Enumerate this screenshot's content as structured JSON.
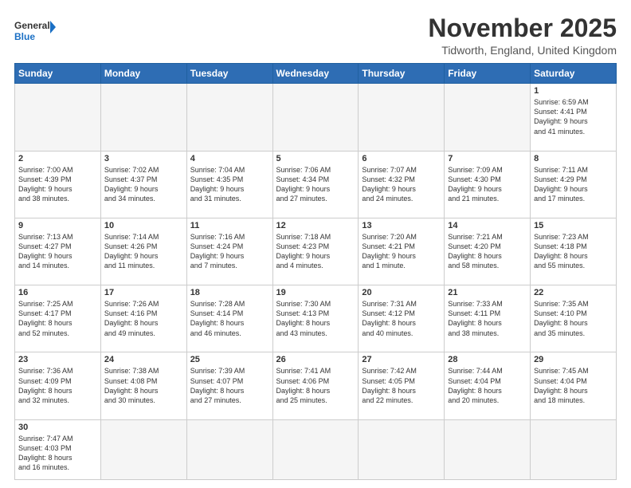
{
  "header": {
    "logo_general": "General",
    "logo_blue": "Blue",
    "month": "November 2025",
    "location": "Tidworth, England, United Kingdom"
  },
  "weekdays": [
    "Sunday",
    "Monday",
    "Tuesday",
    "Wednesday",
    "Thursday",
    "Friday",
    "Saturday"
  ],
  "weeks": [
    [
      {
        "day": "",
        "info": ""
      },
      {
        "day": "",
        "info": ""
      },
      {
        "day": "",
        "info": ""
      },
      {
        "day": "",
        "info": ""
      },
      {
        "day": "",
        "info": ""
      },
      {
        "day": "",
        "info": ""
      },
      {
        "day": "1",
        "info": "Sunrise: 6:59 AM\nSunset: 4:41 PM\nDaylight: 9 hours\nand 41 minutes."
      }
    ],
    [
      {
        "day": "2",
        "info": "Sunrise: 7:00 AM\nSunset: 4:39 PM\nDaylight: 9 hours\nand 38 minutes."
      },
      {
        "day": "3",
        "info": "Sunrise: 7:02 AM\nSunset: 4:37 PM\nDaylight: 9 hours\nand 34 minutes."
      },
      {
        "day": "4",
        "info": "Sunrise: 7:04 AM\nSunset: 4:35 PM\nDaylight: 9 hours\nand 31 minutes."
      },
      {
        "day": "5",
        "info": "Sunrise: 7:06 AM\nSunset: 4:34 PM\nDaylight: 9 hours\nand 27 minutes."
      },
      {
        "day": "6",
        "info": "Sunrise: 7:07 AM\nSunset: 4:32 PM\nDaylight: 9 hours\nand 24 minutes."
      },
      {
        "day": "7",
        "info": "Sunrise: 7:09 AM\nSunset: 4:30 PM\nDaylight: 9 hours\nand 21 minutes."
      },
      {
        "day": "8",
        "info": "Sunrise: 7:11 AM\nSunset: 4:29 PM\nDaylight: 9 hours\nand 17 minutes."
      }
    ],
    [
      {
        "day": "9",
        "info": "Sunrise: 7:13 AM\nSunset: 4:27 PM\nDaylight: 9 hours\nand 14 minutes."
      },
      {
        "day": "10",
        "info": "Sunrise: 7:14 AM\nSunset: 4:26 PM\nDaylight: 9 hours\nand 11 minutes."
      },
      {
        "day": "11",
        "info": "Sunrise: 7:16 AM\nSunset: 4:24 PM\nDaylight: 9 hours\nand 7 minutes."
      },
      {
        "day": "12",
        "info": "Sunrise: 7:18 AM\nSunset: 4:23 PM\nDaylight: 9 hours\nand 4 minutes."
      },
      {
        "day": "13",
        "info": "Sunrise: 7:20 AM\nSunset: 4:21 PM\nDaylight: 9 hours\nand 1 minute."
      },
      {
        "day": "14",
        "info": "Sunrise: 7:21 AM\nSunset: 4:20 PM\nDaylight: 8 hours\nand 58 minutes."
      },
      {
        "day": "15",
        "info": "Sunrise: 7:23 AM\nSunset: 4:18 PM\nDaylight: 8 hours\nand 55 minutes."
      }
    ],
    [
      {
        "day": "16",
        "info": "Sunrise: 7:25 AM\nSunset: 4:17 PM\nDaylight: 8 hours\nand 52 minutes."
      },
      {
        "day": "17",
        "info": "Sunrise: 7:26 AM\nSunset: 4:16 PM\nDaylight: 8 hours\nand 49 minutes."
      },
      {
        "day": "18",
        "info": "Sunrise: 7:28 AM\nSunset: 4:14 PM\nDaylight: 8 hours\nand 46 minutes."
      },
      {
        "day": "19",
        "info": "Sunrise: 7:30 AM\nSunset: 4:13 PM\nDaylight: 8 hours\nand 43 minutes."
      },
      {
        "day": "20",
        "info": "Sunrise: 7:31 AM\nSunset: 4:12 PM\nDaylight: 8 hours\nand 40 minutes."
      },
      {
        "day": "21",
        "info": "Sunrise: 7:33 AM\nSunset: 4:11 PM\nDaylight: 8 hours\nand 38 minutes."
      },
      {
        "day": "22",
        "info": "Sunrise: 7:35 AM\nSunset: 4:10 PM\nDaylight: 8 hours\nand 35 minutes."
      }
    ],
    [
      {
        "day": "23",
        "info": "Sunrise: 7:36 AM\nSunset: 4:09 PM\nDaylight: 8 hours\nand 32 minutes."
      },
      {
        "day": "24",
        "info": "Sunrise: 7:38 AM\nSunset: 4:08 PM\nDaylight: 8 hours\nand 30 minutes."
      },
      {
        "day": "25",
        "info": "Sunrise: 7:39 AM\nSunset: 4:07 PM\nDaylight: 8 hours\nand 27 minutes."
      },
      {
        "day": "26",
        "info": "Sunrise: 7:41 AM\nSunset: 4:06 PM\nDaylight: 8 hours\nand 25 minutes."
      },
      {
        "day": "27",
        "info": "Sunrise: 7:42 AM\nSunset: 4:05 PM\nDaylight: 8 hours\nand 22 minutes."
      },
      {
        "day": "28",
        "info": "Sunrise: 7:44 AM\nSunset: 4:04 PM\nDaylight: 8 hours\nand 20 minutes."
      },
      {
        "day": "29",
        "info": "Sunrise: 7:45 AM\nSunset: 4:04 PM\nDaylight: 8 hours\nand 18 minutes."
      }
    ],
    [
      {
        "day": "30",
        "info": "Sunrise: 7:47 AM\nSunset: 4:03 PM\nDaylight: 8 hours\nand 16 minutes."
      },
      {
        "day": "",
        "info": ""
      },
      {
        "day": "",
        "info": ""
      },
      {
        "day": "",
        "info": ""
      },
      {
        "day": "",
        "info": ""
      },
      {
        "day": "",
        "info": ""
      },
      {
        "day": "",
        "info": ""
      }
    ]
  ]
}
